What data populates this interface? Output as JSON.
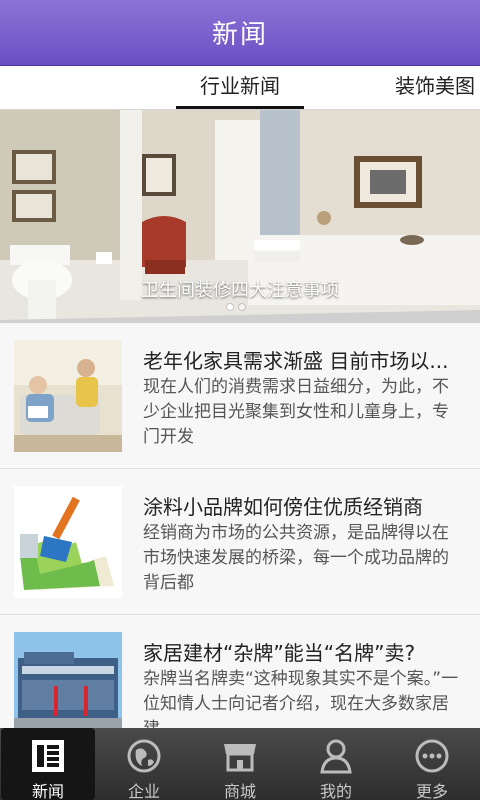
{
  "header": {
    "title": "新闻"
  },
  "tabs": [
    {
      "label": "行业新闻",
      "active": true
    },
    {
      "label": "装饰美图",
      "active": false
    }
  ],
  "banner": {
    "caption": "卫生间装修四大注意事项",
    "page_count": 2,
    "active_index": 0
  },
  "news": [
    {
      "title": "老年化家具需求渐盛 目前市场以...",
      "desc": "现在人们的消费需求日益细分，为此，不少企业把目光聚集到女性和儿童身上，专门开发"
    },
    {
      "title": "涂料小品牌如何傍住优质经销商",
      "desc": "经销商为市场的公共资源，是品牌得以在市场快速发展的桥梁，每一个成功品牌的背后都"
    },
    {
      "title": "家居建材“杂牌”能当“名牌”卖?",
      "desc": "杂牌当名牌卖“这种现象其实不是个案。”一位知情人士向记者介绍，现在大多数家居建"
    }
  ],
  "bottom_nav": [
    {
      "label": "新闻",
      "icon": "newspaper-icon",
      "active": true
    },
    {
      "label": "企业",
      "icon": "globe-icon",
      "active": false
    },
    {
      "label": "商城",
      "icon": "storefront-icon",
      "active": false
    },
    {
      "label": "我的",
      "icon": "person-icon",
      "active": false
    },
    {
      "label": "更多",
      "icon": "more-icon",
      "active": false
    }
  ],
  "colors": {
    "header_top": "#8b74d6",
    "header_bottom": "#6a4fc4",
    "nav_bg": "#3a3a3a"
  }
}
